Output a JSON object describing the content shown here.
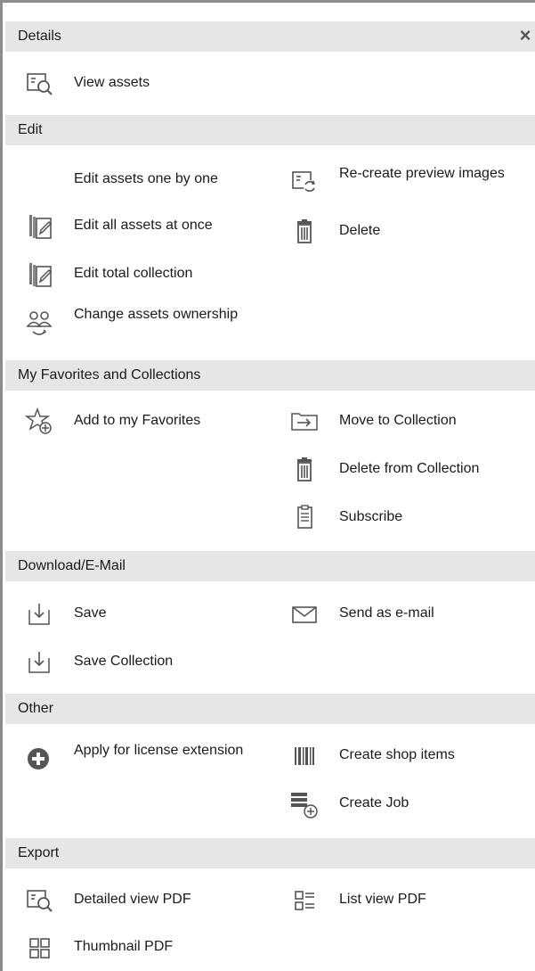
{
  "details": {
    "header": "Details",
    "close_glyph": "×",
    "items": [
      {
        "label": "View assets",
        "icon": "preview-icon"
      }
    ]
  },
  "edit": {
    "header": "Edit",
    "left": [
      {
        "label": "Edit assets one by one",
        "icon": ""
      },
      {
        "label": "Edit all assets at once",
        "icon": "edit-multiple-icon"
      },
      {
        "label": "Edit total collection",
        "icon": "edit-collection-icon"
      },
      {
        "label": "Change assets ownership",
        "icon": "change-owner-icon"
      }
    ],
    "right": [
      {
        "label": "Re-create preview images",
        "icon": "recreate-preview-icon"
      },
      {
        "label": "Delete",
        "icon": "trash-icon"
      }
    ]
  },
  "favorites": {
    "header": "My Favorites and Collections",
    "left": [
      {
        "label": "Add to my Favorites",
        "icon": "star-add-icon"
      }
    ],
    "right": [
      {
        "label": "Move to Collection",
        "icon": "move-to-collection-icon"
      },
      {
        "label": "Delete from Collection",
        "icon": "trash-icon"
      },
      {
        "label": "Subscribe",
        "icon": "clipboard-icon"
      }
    ]
  },
  "download": {
    "header": "Download/E-Mail",
    "left": [
      {
        "label": "Save",
        "icon": "download-icon"
      },
      {
        "label": "Save Collection",
        "icon": "download-icon"
      }
    ],
    "right": [
      {
        "label": "Send as e-mail",
        "icon": "envelope-icon"
      }
    ]
  },
  "other": {
    "header": "Other",
    "left": [
      {
        "label": "Apply for license extension",
        "icon": "plus-circle-icon"
      }
    ],
    "right": [
      {
        "label": "Create shop items",
        "icon": "barcode-icon"
      },
      {
        "label": "Create Job",
        "icon": "job-add-icon"
      }
    ]
  },
  "export": {
    "header": "Export",
    "left": [
      {
        "label": "Detailed view PDF",
        "icon": "preview-icon"
      },
      {
        "label": "Thumbnail PDF",
        "icon": "thumbnail-grid-icon"
      }
    ],
    "right": [
      {
        "label": "List view PDF",
        "icon": "list-view-icon"
      }
    ]
  },
  "colors": {
    "header_bg": "#e6e6e6",
    "icon": "#555555",
    "border": "#8c8c8c"
  }
}
